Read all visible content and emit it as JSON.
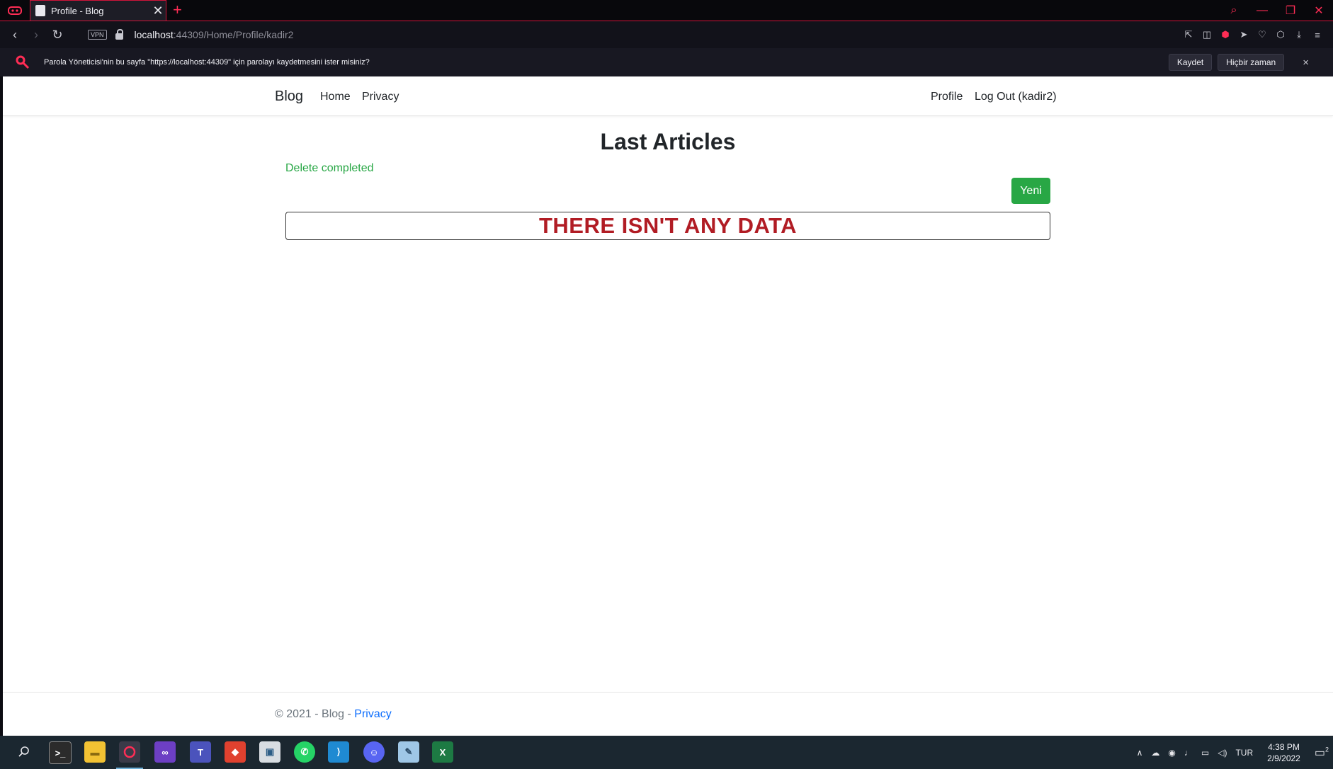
{
  "browser": {
    "tab": {
      "title": "Profile - Blog",
      "close": "✕"
    },
    "new_tab": "+",
    "window_controls": {
      "search": "⌕",
      "minimize": "—",
      "restore": "❐",
      "close": "✕"
    },
    "url": {
      "host": "localhost",
      "path": ":44309/Home/Profile/kadir2"
    },
    "vpn_label": "VPN",
    "password_prompt": {
      "message": "Parola Yöneticisi'nin bu sayfa \"https://localhost:44309\" için parolayı kaydetmesini ister misiniz?",
      "save_label": "Kaydet",
      "never_label": "Hiçbir zaman",
      "close": "×"
    }
  },
  "page": {
    "navbar": {
      "brand": "Blog",
      "home": "Home",
      "privacy": "Privacy",
      "profile": "Profile",
      "logout": "Log Out (kadir2)"
    },
    "heading": "Last Articles",
    "status_message": "Delete completed",
    "new_button": "Yeni",
    "empty_message": "THERE ISN'T ANY DATA",
    "footer": {
      "text": "© 2021 - Blog - ",
      "link": "Privacy"
    }
  },
  "taskbar": {
    "language": "TUR",
    "time": "4:38 PM",
    "date": "2/9/2022",
    "notification_count": "2",
    "apps": [
      "search",
      "terminal",
      "file-explorer",
      "opera-gx",
      "visual-studio",
      "teams",
      "git-client",
      "image-viewer",
      "whatsapp",
      "vscode",
      "discord",
      "notepad",
      "excel"
    ]
  },
  "colors": {
    "accent": "#ff2d55",
    "success": "#28a745",
    "danger_text": "#b11c24",
    "link": "#0d6efd"
  }
}
